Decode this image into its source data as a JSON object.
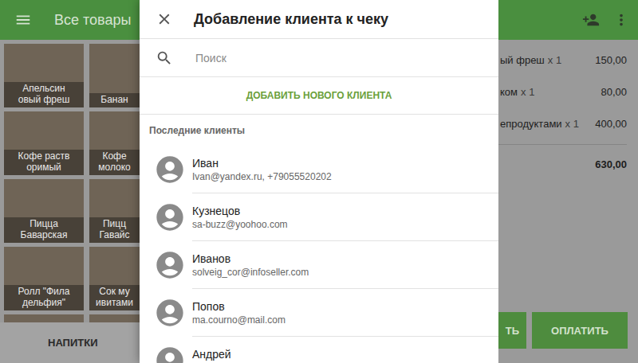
{
  "app": {
    "title": "Все товары",
    "category": "НАПИТКИ",
    "products": [
      {
        "lines": [
          "Апельсин",
          "овый фреш"
        ]
      },
      {
        "lines": [
          "Банан"
        ]
      },
      {
        "lines": [
          "Кофе раств",
          "оримый"
        ]
      },
      {
        "lines": [
          "Кофе",
          "молоко"
        ]
      },
      {
        "lines": [
          "Пицца",
          "Баварская"
        ]
      },
      {
        "lines": [
          "Пицц",
          "Гавайс"
        ]
      },
      {
        "lines": [
          "Ролл \"Фила",
          "дельфия\""
        ]
      },
      {
        "lines": [
          "Сок му",
          "ивитами"
        ]
      },
      {
        "lines": []
      },
      {
        "lines": []
      }
    ]
  },
  "receipt": {
    "items": [
      {
        "name": "ый фреш",
        "qty": "x 1",
        "amount": "150,00"
      },
      {
        "name": "ком",
        "qty": "x 1",
        "amount": "80,00"
      },
      {
        "name": "епродуктами",
        "qty": "x 1",
        "amount": "400,00"
      }
    ],
    "total": "630,00",
    "buttons": [
      "ТЬ",
      "ОПЛАТИТЬ"
    ]
  },
  "dialog": {
    "title": "Добавление клиента к чеку",
    "search_placeholder": "Поиск",
    "add_button": "ДОБАВИТЬ НОВОГО КЛИЕНТА",
    "section": "Последние клиенты",
    "clients": [
      {
        "name": "Иван",
        "contact": "Ivan@yandex.ru, +79055520202"
      },
      {
        "name": "Кузнецов",
        "contact": "sa-buzz@yoohoo.com"
      },
      {
        "name": "Иванов",
        "contact": "solveig_cor@infoseller.com"
      },
      {
        "name": "Попов",
        "contact": "ma.courno@mail.com"
      },
      {
        "name": "Андрей",
        "contact": ""
      }
    ]
  }
}
